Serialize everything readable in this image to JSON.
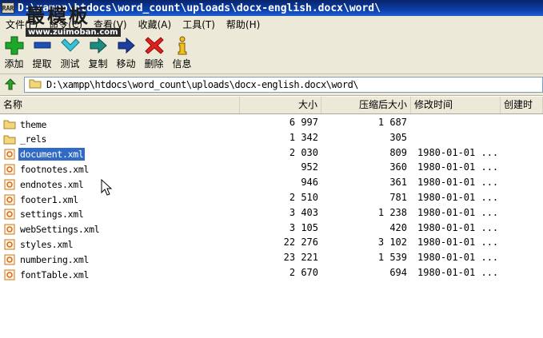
{
  "window": {
    "title": "D:\\xampp\\htdocs\\word_count\\uploads\\docx-english.docx\\word\\",
    "app_icon": "rar-archive-icon"
  },
  "watermark": {
    "text": "最模板",
    "url": "www.zuimoban.com"
  },
  "menu": [
    {
      "label": "文件(F)"
    },
    {
      "label": "命令(C)"
    },
    {
      "label": "查看(V)"
    },
    {
      "label": "收藏(A)"
    },
    {
      "label": "工具(T)"
    },
    {
      "label": "帮助(H)"
    }
  ],
  "toolbar": [
    {
      "label": "添加",
      "icon": "plus-icon"
    },
    {
      "label": "提取",
      "icon": "minus-icon"
    },
    {
      "label": "测试",
      "icon": "check-icon"
    },
    {
      "label": "复制",
      "icon": "copy-arrow-icon"
    },
    {
      "label": "移动",
      "icon": "move-arrow-icon"
    },
    {
      "label": "删除",
      "icon": "delete-x-icon"
    },
    {
      "label": "信息",
      "icon": "info-icon"
    }
  ],
  "address": {
    "path": "D:\\xampp\\htdocs\\word_count\\uploads\\docx-english.docx\\word\\"
  },
  "columns": {
    "name": "名称",
    "size": "大小",
    "packed": "压缩后大小",
    "modified": "修改时间",
    "created": "创建时"
  },
  "files": [
    {
      "name": "theme",
      "type": "folder",
      "size": "6 997",
      "packed": "1 687",
      "modified": "",
      "selected": false
    },
    {
      "name": "_rels",
      "type": "folder",
      "size": "1 342",
      "packed": "305",
      "modified": "",
      "selected": false
    },
    {
      "name": "document.xml",
      "type": "xml",
      "size": "2 030",
      "packed": "809",
      "modified": "1980-01-01 ...",
      "selected": true
    },
    {
      "name": "footnotes.xml",
      "type": "xml",
      "size": "952",
      "packed": "360",
      "modified": "1980-01-01 ...",
      "selected": false
    },
    {
      "name": "endnotes.xml",
      "type": "xml",
      "size": "946",
      "packed": "361",
      "modified": "1980-01-01 ...",
      "selected": false
    },
    {
      "name": "footer1.xml",
      "type": "xml",
      "size": "2 510",
      "packed": "781",
      "modified": "1980-01-01 ...",
      "selected": false
    },
    {
      "name": "settings.xml",
      "type": "xml",
      "size": "3 403",
      "packed": "1 238",
      "modified": "1980-01-01 ...",
      "selected": false
    },
    {
      "name": "webSettings.xml",
      "type": "xml",
      "size": "3 105",
      "packed": "420",
      "modified": "1980-01-01 ...",
      "selected": false
    },
    {
      "name": "styles.xml",
      "type": "xml",
      "size": "22 276",
      "packed": "3 102",
      "modified": "1980-01-01 ...",
      "selected": false
    },
    {
      "name": "numbering.xml",
      "type": "xml",
      "size": "23 221",
      "packed": "1 539",
      "modified": "1980-01-01 ...",
      "selected": false
    },
    {
      "name": "fontTable.xml",
      "type": "xml",
      "size": "2 670",
      "packed": "694",
      "modified": "1980-01-01 ...",
      "selected": false
    }
  ],
  "colors": {
    "selection": "#316ac5",
    "chrome": "#ece9d8",
    "titlebar": "#0a246a"
  }
}
